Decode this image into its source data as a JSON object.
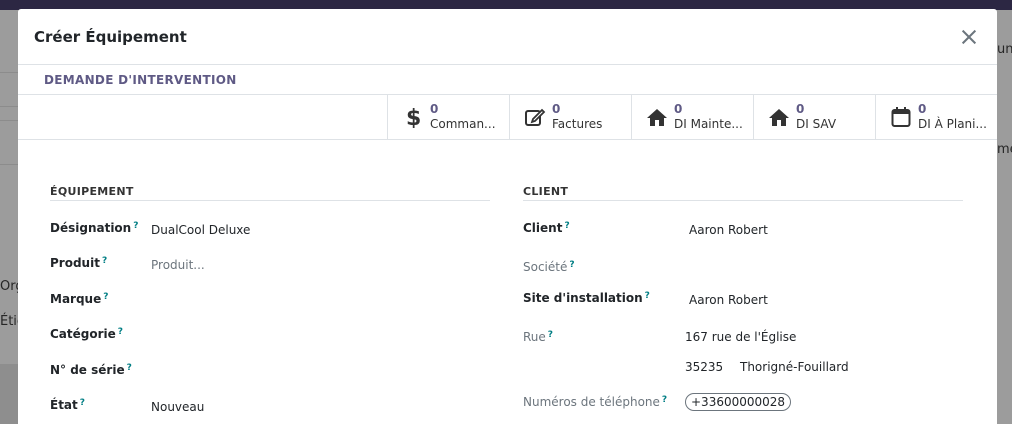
{
  "background": {
    "fragments": [
      "une",
      "me",
      "Org",
      "Étic"
    ]
  },
  "modal": {
    "title": "Créer Équipement",
    "statusbar": {
      "button_label": "DEMANDE D'INTERVENTION"
    },
    "smart_buttons": [
      {
        "value": "0",
        "label": "Comman...",
        "icon": "dollar-icon"
      },
      {
        "value": "0",
        "label": "Factures",
        "icon": "edit-icon"
      },
      {
        "value": "0",
        "label": "DI Mainte...",
        "icon": "home-icon"
      },
      {
        "value": "0",
        "label": "DI SAV",
        "icon": "home-icon"
      },
      {
        "value": "0",
        "label": "DI À Plani...",
        "icon": "calendar-icon"
      }
    ],
    "equipment": {
      "title": "ÉQUIPEMENT",
      "fields": {
        "designation": {
          "label": "Désignation",
          "value": "DualCool Deluxe"
        },
        "produit": {
          "label": "Produit",
          "placeholder": "Produit..."
        },
        "marque": {
          "label": "Marque"
        },
        "categorie": {
          "label": "Catégorie"
        },
        "serie": {
          "label": "N° de série"
        },
        "etat": {
          "label": "État",
          "value": "Nouveau"
        }
      }
    },
    "client": {
      "title": "CLIENT",
      "fields": {
        "client": {
          "label": "Client",
          "value": "Aaron Robert"
        },
        "societe": {
          "label": "Société"
        },
        "site": {
          "label": "Site d'installation",
          "value": "Aaron Robert"
        },
        "rue": {
          "label": "Rue",
          "value": "167 rue de l'Église",
          "zip": "35235",
          "city": "Thorigné-Fouillard"
        },
        "phones": {
          "label": "Numéros de téléphone",
          "value": "+33600000028"
        }
      }
    },
    "help_mark": "?"
  }
}
